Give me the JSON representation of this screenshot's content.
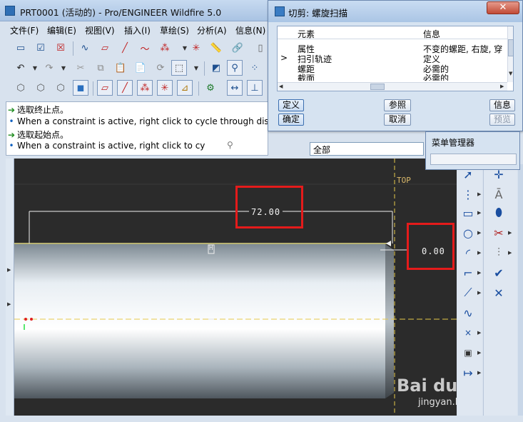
{
  "main_window": {
    "title": "PRT0001 (活动的) - Pro/ENGINEER Wildfire 5.0"
  },
  "menubar": {
    "items": [
      {
        "label": "文件(F)"
      },
      {
        "label": "编辑(E)"
      },
      {
        "label": "视图(V)"
      },
      {
        "label": "插入(I)"
      },
      {
        "label": "草绘(S)"
      },
      {
        "label": "分析(A)"
      },
      {
        "label": "信息(N)"
      }
    ]
  },
  "messages": [
    {
      "type": "prompt",
      "text": "选取终止点。"
    },
    {
      "type": "info",
      "text": "When a constraint is active, right click to cycle through disab"
    },
    {
      "type": "prompt",
      "text": "选取起始点。"
    },
    {
      "type": "info",
      "text": "When a constraint is active, right click to cy"
    }
  ],
  "filter": {
    "value": "全部"
  },
  "dialog": {
    "title": "切剪: 螺旋扫描",
    "columns": [
      "元素",
      "信息"
    ],
    "rows": [
      {
        "marker": "",
        "element": "属性",
        "info": "不变的螺距, 右旋, 穿"
      },
      {
        "marker": ">",
        "element": "扫引轨迹",
        "info": "定义"
      },
      {
        "marker": "",
        "element": "螺距",
        "info": "必需的"
      },
      {
        "marker": "",
        "element": "截面",
        "info": "必需的"
      }
    ],
    "buttons": {
      "define": "定义",
      "refs": "参照",
      "info": "信息",
      "ok": "确定",
      "cancel": "取消",
      "preview": "预览"
    }
  },
  "menu_manager": {
    "title": "菜单管理器"
  },
  "graphics": {
    "datum_label": "TOP",
    "h_constraint": "H",
    "dimensions": {
      "length": "72.00",
      "offset": "0.00"
    }
  },
  "watermark": {
    "logo": "Bai du 经验",
    "url": "jingyan.baidu.com"
  },
  "colors": {
    "graphics_bg": "#2b2b2b",
    "highlight_box": "#e41b1b",
    "sketch_line": "#e6e08a",
    "centerline": "#e6c84a"
  }
}
